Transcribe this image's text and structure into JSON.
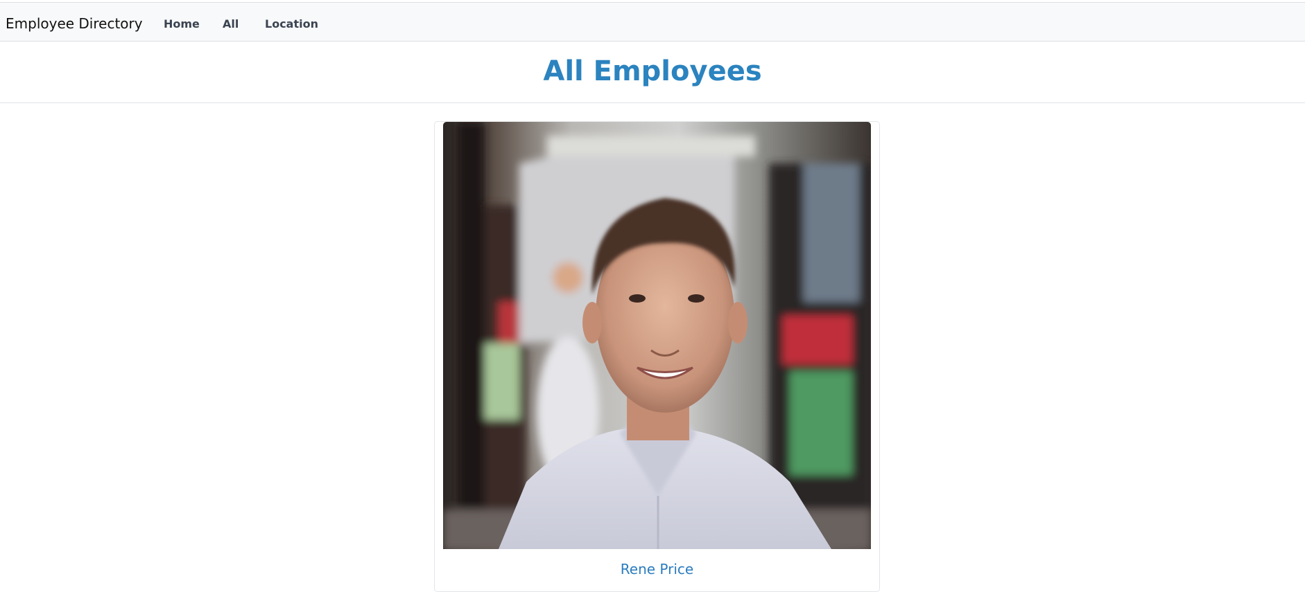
{
  "navbar": {
    "brand": "Employee Directory",
    "links": [
      {
        "label": "Home"
      },
      {
        "label": "All"
      },
      {
        "label": "Location"
      }
    ]
  },
  "header": {
    "title": "All Employees"
  },
  "employees": [
    {
      "name": "Rene Price",
      "photo_icon": "employee-photo"
    }
  ],
  "colors": {
    "accent": "#2b83bf",
    "navbar_bg": "#f8f9fa"
  }
}
